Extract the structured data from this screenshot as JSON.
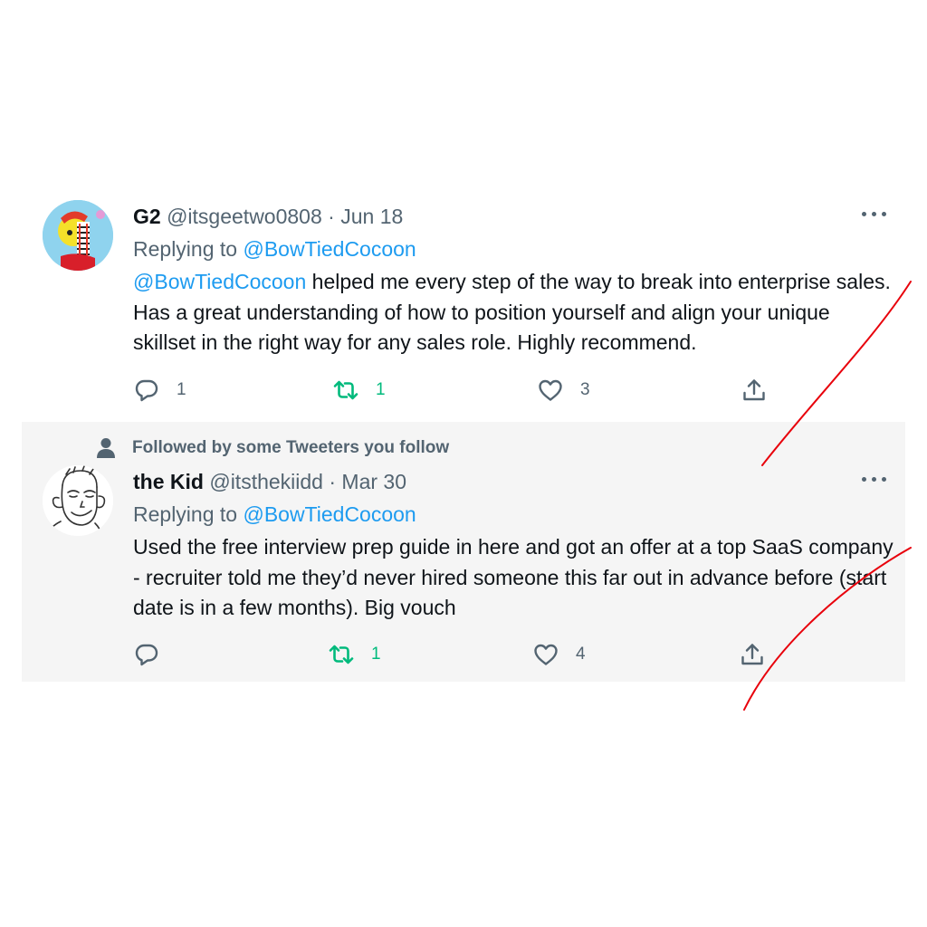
{
  "tweets": [
    {
      "name": "G2",
      "handle": "@itsgeetwo0808",
      "separator": "·",
      "date": "Jun 18",
      "replying_prefix": "Replying to",
      "replying_to": "@BowTiedCocoon",
      "body_mention": "@BowTiedCocoon",
      "body_text": " helped me every step of the way to break into enterprise sales. Has a great understanding of how to position yourself and align your unique skillset  in the right way for any sales role. Highly recommend.",
      "actions": {
        "reply_count": "1",
        "retweet_count": "1",
        "like_count": "3"
      }
    },
    {
      "social_context": "Followed by some Tweeters you follow",
      "name": "the Kid",
      "handle": "@itsthekiidd",
      "separator": "·",
      "date": "Mar 30",
      "replying_prefix": "Replying to",
      "replying_to": "@BowTiedCocoon",
      "body_text": "Used the free interview prep guide in here and got an offer at a top SaaS company - recruiter told me they’d never hired someone this far out in advance before (start date is in a few months). Big vouch",
      "actions": {
        "reply_count": "",
        "retweet_count": "1",
        "like_count": "4"
      }
    }
  ],
  "icons": {
    "reply": "reply-icon",
    "retweet": "retweet-icon",
    "like": "heart-icon",
    "share": "share-icon",
    "more": "more-icon",
    "person": "person-icon"
  },
  "colors": {
    "link": "#1d9bf0",
    "secondary_text": "#536471",
    "retweet_green": "#00ba7c",
    "annotation_red": "#e8000b",
    "highlight_background": "#f5f5f5"
  }
}
